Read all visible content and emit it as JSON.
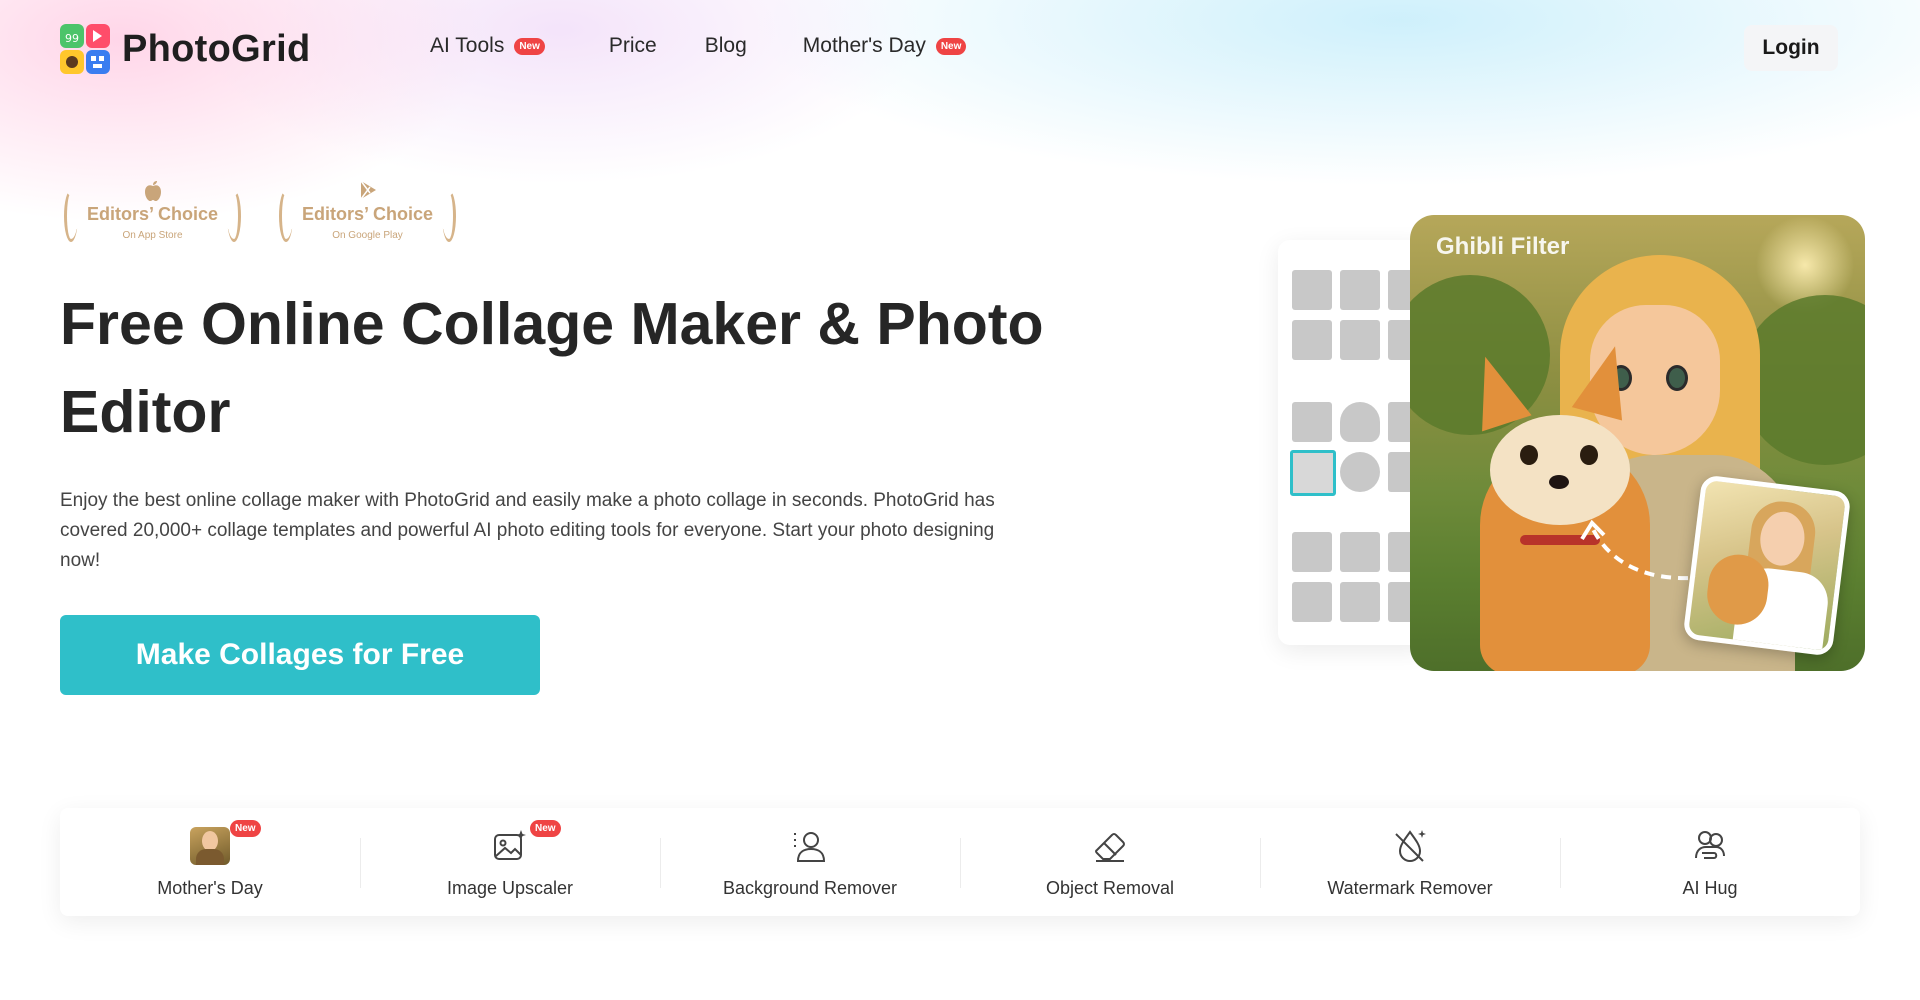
{
  "app": {
    "name": "PhotoGrid"
  },
  "nav": {
    "items": [
      {
        "label": "AI Tools",
        "badge": "New"
      },
      {
        "label": "Price"
      },
      {
        "label": "Blog"
      },
      {
        "label": "Mother's Day",
        "badge": "New"
      }
    ],
    "login_label": "Login"
  },
  "awards": [
    {
      "icon": "apple-icon",
      "title": "Editors’ Choice",
      "subtitle": "On App Store"
    },
    {
      "icon": "google-play-icon",
      "title": "Editors’ Choice",
      "subtitle": "On Google Play"
    }
  ],
  "hero": {
    "title": "Free Online Collage Maker & Photo Editor",
    "description": "Enjoy the best online collage maker with PhotoGrid and easily make a photo collage in seconds. PhotoGrid has covered 20,000+ collage templates and powerful AI photo editing tools for everyone. Start your photo designing now!",
    "cta_label": "Make Collages for Free",
    "visual_label": "Ghibli Filter"
  },
  "tools": [
    {
      "label": "Mother's Day",
      "icon": "mothers-day-thumbnail",
      "badge": "New"
    },
    {
      "label": "Image Upscaler",
      "icon": "image-upscale-icon",
      "badge": "New"
    },
    {
      "label": "Background Remover",
      "icon": "person-cutout-icon"
    },
    {
      "label": "Object Removal",
      "icon": "eraser-icon"
    },
    {
      "label": "Watermark Remover",
      "icon": "drop-off-icon"
    },
    {
      "label": "AI Hug",
      "icon": "hug-icon"
    }
  ],
  "colors": {
    "accent": "#2fbfc9",
    "badge": "#ef4444",
    "award": "#c9a57a",
    "text": "#262626"
  }
}
